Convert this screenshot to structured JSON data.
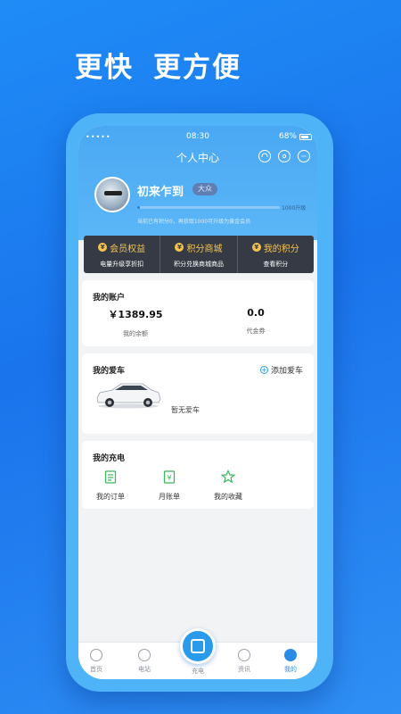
{
  "headline": {
    "part1": "更快",
    "part2": "更方便"
  },
  "status_bar": {
    "signal": "•••••",
    "time": "08:30",
    "battery": "68%"
  },
  "header": {
    "title": "个人中心",
    "icons": [
      "headset-icon",
      "settings-icon",
      "message-icon"
    ]
  },
  "profile": {
    "username": "初来乍到",
    "level_badge": "大众",
    "progress_label": "1000升级",
    "progress": 0.0,
    "points_note": "当前已有积分0，再获取1000可升级为黄金会员"
  },
  "benefits": [
    {
      "title": "会员权益",
      "subtitle": "电量升级享折扣"
    },
    {
      "title": "积分商城",
      "subtitle": "积分兑换商城商品"
    },
    {
      "title": "我的积分",
      "subtitle": "查看积分"
    }
  ],
  "account": {
    "title": "我的账户",
    "balance_value": "￥1389.95",
    "balance_label": "我的余额",
    "coupon_value": "0.0",
    "coupon_label": "代金券"
  },
  "cars": {
    "title": "我的爱车",
    "add_label": "添加爱车",
    "empty_label": "暂无爱车"
  },
  "charging": {
    "title": "我的充电",
    "items": [
      {
        "label": "我的订单",
        "icon": "order-icon"
      },
      {
        "label": "月账单",
        "icon": "bill-icon"
      },
      {
        "label": "我的收藏",
        "icon": "star-icon"
      }
    ]
  },
  "tabbar": {
    "tabs": [
      {
        "label": "首页",
        "icon": "home-icon"
      },
      {
        "label": "电站",
        "icon": "station-icon"
      },
      {
        "label": "充电",
        "icon": "scan-icon"
      },
      {
        "label": "资讯",
        "icon": "news-icon"
      },
      {
        "label": "我的",
        "icon": "profile-icon"
      }
    ],
    "active": "我的",
    "accent": "#2a8ae8"
  }
}
